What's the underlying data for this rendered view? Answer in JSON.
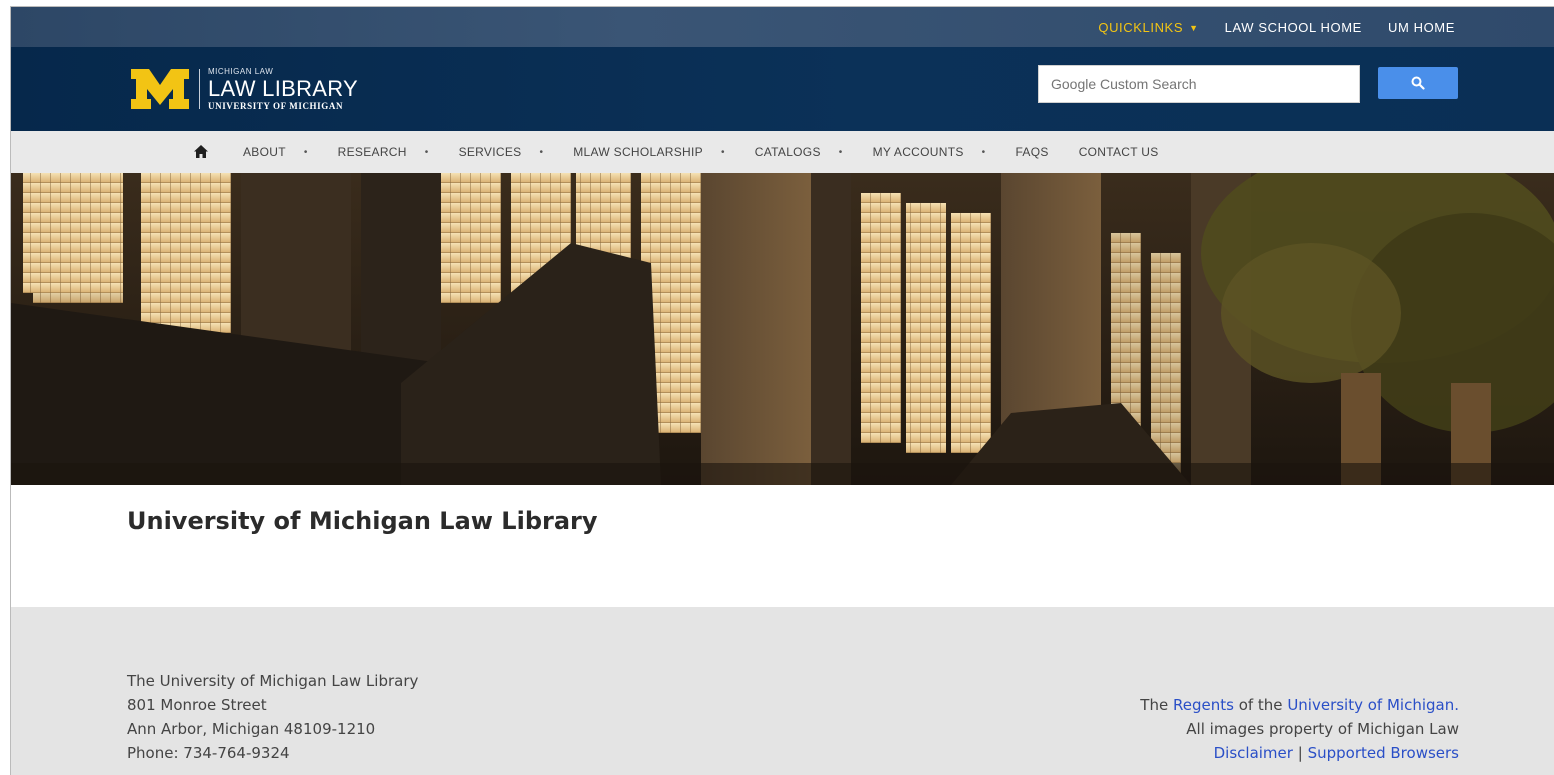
{
  "topbar": {
    "quicklinks_label": "QUICKLINKS",
    "law_school_home_label": "LAW SCHOOL HOME",
    "um_home_label": "UM HOME"
  },
  "header": {
    "logo_small": "MICHIGAN LAW",
    "logo_big": "LAW LIBRARY",
    "logo_university": "UNIVERSITY OF MICHIGAN",
    "search_placeholder": "Google Custom Search"
  },
  "nav": {
    "items": [
      {
        "label": "ABOUT",
        "has_dropdown": true
      },
      {
        "label": "RESEARCH",
        "has_dropdown": true
      },
      {
        "label": "SERVICES",
        "has_dropdown": true
      },
      {
        "label": "MLAW SCHOLARSHIP",
        "has_dropdown": true
      },
      {
        "label": "CATALOGS",
        "has_dropdown": true
      },
      {
        "label": "MY ACCOUNTS",
        "has_dropdown": true
      },
      {
        "label": "FAQS",
        "has_dropdown": false
      },
      {
        "label": "CONTACT US",
        "has_dropdown": false
      }
    ],
    "dropdown_marker": "•"
  },
  "main": {
    "page_title": "University of Michigan Law Library"
  },
  "footer": {
    "address": {
      "name": "The University of Michigan Law Library",
      "street": "801 Monroe Street",
      "city": "Ann Arbor, Michigan 48109-1210",
      "phone": "Phone: 734-764-9324"
    },
    "rights": {
      "the": "The",
      "regents_link": "Regents",
      "of_the": "of the",
      "university_link": "University of Michigan.",
      "images_note": "All images property of Michigan Law",
      "disclaimer_link": "Disclaimer",
      "separator": "|",
      "browsers_link": "Supported Browsers"
    }
  },
  "colors": {
    "maize": "#f2c414",
    "blue": "#06284b",
    "search_button": "#4a8fea",
    "footer_link": "#2a4fc7"
  },
  "icons": {
    "home": "home-icon",
    "search": "search-icon",
    "caret": "caret-down-icon"
  }
}
